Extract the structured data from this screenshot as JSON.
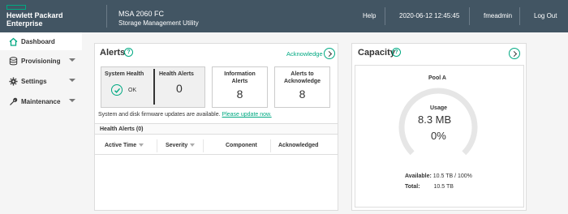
{
  "header": {
    "logo_line1": "Hewlett Packard",
    "logo_line2": "Enterprise",
    "product_name": "MSA 2060 FC",
    "product_sub": "Storage Management Utility",
    "help": "Help",
    "datetime": "2020-06-12 12:45:45",
    "user": "fmeadmin",
    "logout": "Log Out"
  },
  "sidebar": {
    "items": [
      {
        "label": "Dashboard",
        "icon": "home-icon",
        "active": true
      },
      {
        "label": "Provisioning",
        "icon": "database-icon"
      },
      {
        "label": "Settings",
        "icon": "gear-icon"
      },
      {
        "label": "Maintenance",
        "icon": "wrench-icon"
      }
    ]
  },
  "alerts": {
    "title": "Alerts",
    "acknowledge": "Acknowledge",
    "system_health_label": "System Health",
    "system_health_status": "OK",
    "health_alerts_label": "Health Alerts",
    "health_alerts_value": "0",
    "information_alerts_label_1": "Information",
    "information_alerts_label_2": "Alerts",
    "information_alerts_value": "8",
    "to_ack_label_1": "Alerts to",
    "to_ack_label_2": "Acknowledge",
    "to_ack_value": "8",
    "firmware_msg": "System and disk firmware updates are available.",
    "firmware_link": "Please update now.",
    "health_alerts_table_title": "Health Alerts (0)",
    "columns": [
      "Active Time",
      "Severity",
      "Component",
      "Acknowledged"
    ]
  },
  "capacity": {
    "title": "Capacity",
    "pool": "Pool A",
    "usage_label": "Usage",
    "usage_value": "8.3 MB",
    "usage_percent": "0%",
    "usage_fraction": 0,
    "available_label": "Available:",
    "available_value": "10.5 TB / 100%",
    "total_label": "Total:",
    "total_value": "10.5 TB"
  },
  "colors": {
    "header_bg": "#425563",
    "accent": "#01a982",
    "gauge_track": "#e6e6e6"
  }
}
